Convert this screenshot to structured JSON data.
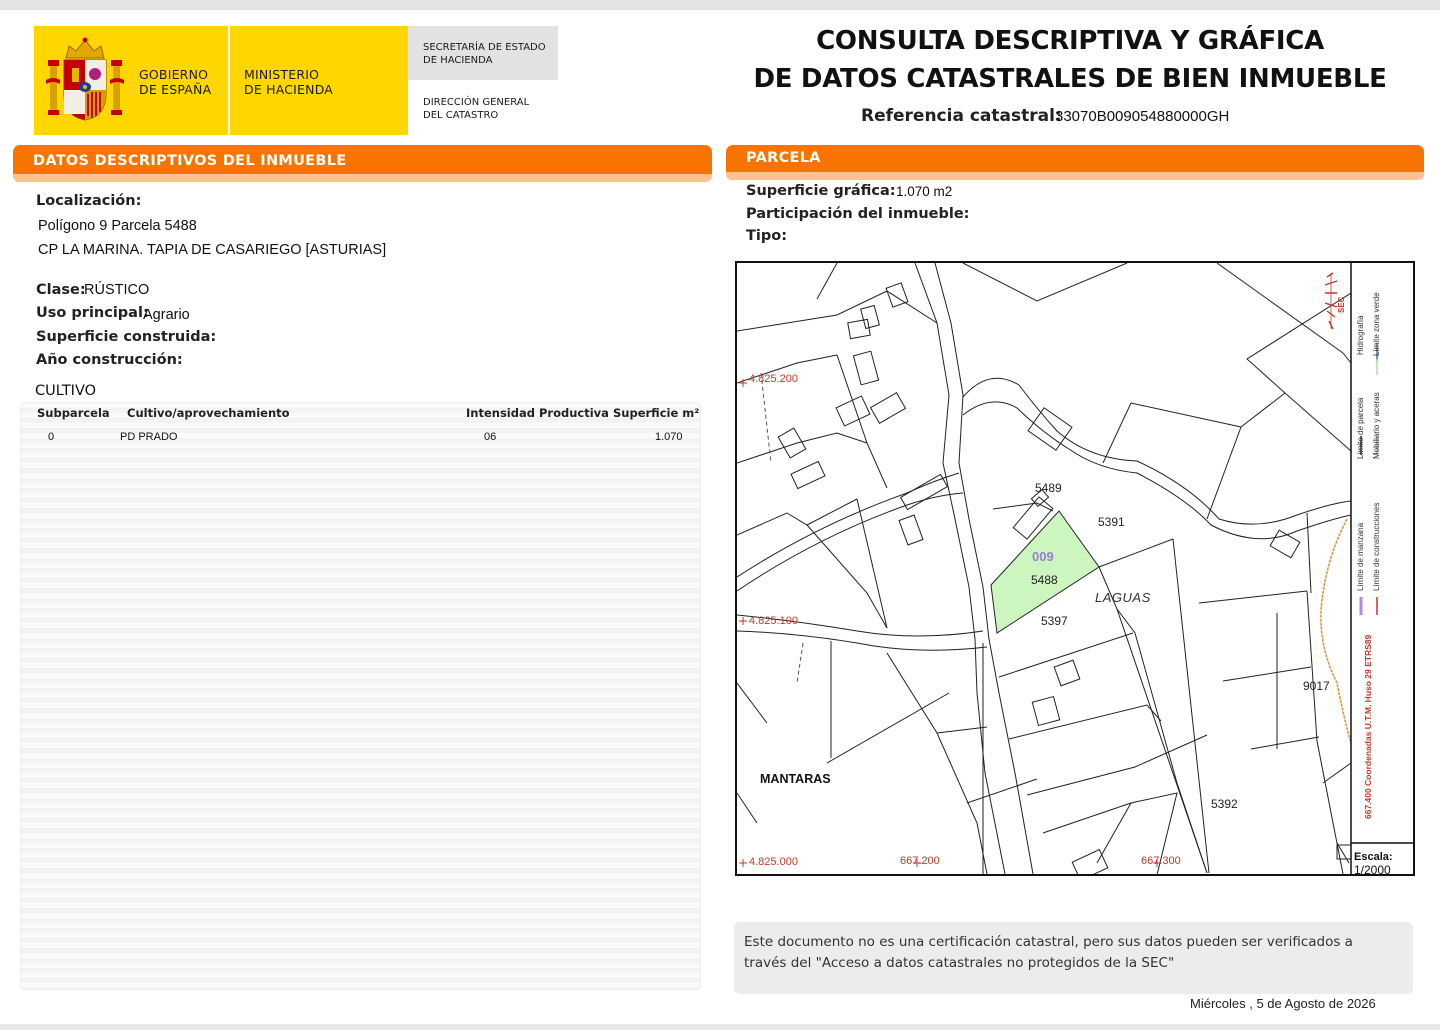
{
  "header": {
    "gov_line1": "GOBIERNO",
    "gov_line2": "DE ESPAÑA",
    "min_line1": "MINISTERIO",
    "min_line2": "DE HACIENDA",
    "sec_line1": "SECRETARÍA DE ESTADO",
    "sec_line2": "DE HACIENDA",
    "dir_line1": "DIRECCIÓN GENERAL",
    "dir_line2": "DEL CATASTRO",
    "title_line1": "CONSULTA DESCRIPTIVA Y GRÁFICA",
    "title_line2": "DE DATOS CATASTRALES DE BIEN INMUEBLE",
    "ref_label": "Referencia catastral:",
    "ref_value": "33070B009054880000GH"
  },
  "datos": {
    "section_title": "DATOS DESCRIPTIVOS DEL INMUEBLE",
    "localizacion_label": "Localización:",
    "localizacion_line1": "Polígono 9 Parcela 5488",
    "localizacion_line2": "CP LA MARINA. TAPIA DE CASARIEGO [ASTURIAS]",
    "clase_label": "Clase:",
    "clase_value": "RÚSTICO",
    "uso_label": "Uso principal:",
    "uso_value": "Agrario",
    "superficie_label": "Superficie construida:",
    "anio_label": "Año construcción:"
  },
  "cultivo": {
    "title": "CULTIVO",
    "headers": [
      "Subparcela",
      "Cultivo/aprovechamiento",
      "Intensidad Productiva",
      "Superficie m²"
    ],
    "rows": [
      [
        "0",
        "PD PRADO",
        "06",
        "1.070"
      ]
    ]
  },
  "parcela": {
    "section_title": "PARCELA",
    "superficie_label": "Superficie gráfica:",
    "superficie_value": "1.070 m2",
    "participacion_label": "Participación del inmueble:",
    "tipo_label": "Tipo:"
  },
  "map": {
    "coords": {
      "y1": "4.825.200",
      "y2": "4.825.100",
      "y3": "4.825.000",
      "x1": "667.200",
      "x2": "667.300"
    },
    "labels": {
      "p5489": "5489",
      "p5391": "5391",
      "poly": "009",
      "p5488": "5488",
      "laguas": "LAGUAS",
      "p5397": "5397",
      "p9017": "9017",
      "mantaras": "MANTARAS",
      "p5392": "5392"
    },
    "logo_text": "SEC",
    "legend": {
      "limite_parcela": "Límite de parcela",
      "hidrografia": "Hidrografía",
      "mobiliario": "Mobiliario y aceras",
      "zona_verde": "Límite zona verde",
      "limite_manzana": "Límite de manzana",
      "limite_construcciones": "Límite de construcciones",
      "coordenadas": "667.400 Coordenadas U.T.M. Huso 29 ETRS89"
    },
    "escala_label": "Escala:",
    "escala_value": "1/2000",
    "colors": {
      "parcel_fill": "#cdf5c0",
      "coord_red": "#c0392b",
      "poly_purple": "#9b7fd0"
    }
  },
  "footer": {
    "disclaimer": "Este documento no es una certificación catastral, pero sus datos pueden ser verificados a través del \"Acceso a datos catastrales no protegidos de la SEC\"",
    "date": "Miércoles , 5 de Agosto de 2026"
  }
}
